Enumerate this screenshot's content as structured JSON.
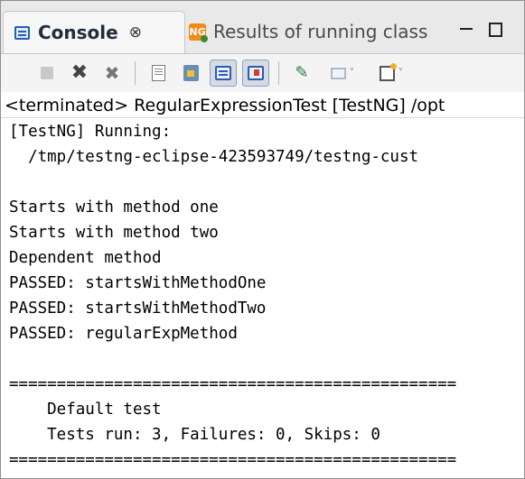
{
  "tabs": {
    "active": {
      "label": "Console",
      "close_glyph": "⊗"
    },
    "inactive": {
      "label": "Results of running class",
      "icon_text": "NG"
    }
  },
  "toolbar": {
    "icons": [
      "terminate-icon",
      "remove-launch-icon",
      "remove-all-terminated-icon",
      "clear-console-icon",
      "scroll-lock-icon",
      "show-console-on-stdout-icon",
      "show-console-on-stderr-icon",
      "pin-console-icon",
      "display-selected-console-icon",
      "open-console-icon"
    ],
    "caret_glyph": "˅"
  },
  "process": {
    "label": "<terminated> RegularExpressionTest [TestNG] /opt"
  },
  "console": {
    "lines": [
      "[TestNG] Running:",
      "  /tmp/testng-eclipse-423593749/testng-cust",
      "",
      "Starts with method one",
      "Starts with method two",
      "Dependent method",
      "PASSED: startsWithMethodOne",
      "PASSED: startsWithMethodTwo",
      "PASSED: regularExpMethod",
      "",
      "===============================================",
      "    Default test",
      "    Tests run: 3, Failures: 0, Skips: 0",
      "==============================================="
    ]
  },
  "colors": {
    "accent": "#2a5db0",
    "testng_orange": "#f08c1a",
    "toolbar_pressed": "#d4dbe4"
  }
}
